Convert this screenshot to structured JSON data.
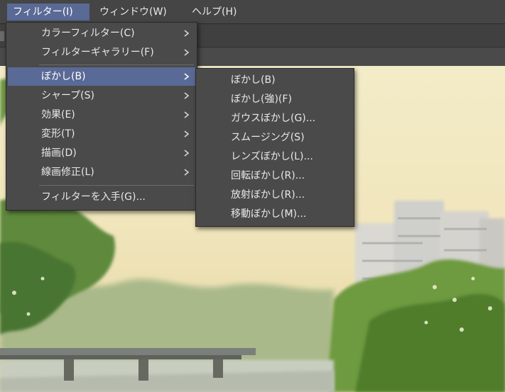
{
  "menubar": {
    "items": [
      {
        "label": "フィルター(I)",
        "active": true
      },
      {
        "label": "ウィンドウ(W)",
        "active": false
      },
      {
        "label": "ヘルプ(H)",
        "active": false
      }
    ]
  },
  "filter_menu": {
    "items": [
      {
        "label": "カラーフィルター(C)",
        "submenu": true
      },
      {
        "label": "フィルターギャラリー(F)",
        "submenu": true
      },
      {
        "label": "ぼかし(B)",
        "submenu": true,
        "highlighted": true
      },
      {
        "label": "シャープ(S)",
        "submenu": true
      },
      {
        "label": "効果(E)",
        "submenu": true
      },
      {
        "label": "変形(T)",
        "submenu": true
      },
      {
        "label": "描画(D)",
        "submenu": true
      },
      {
        "label": "線画修正(L)",
        "submenu": true
      },
      {
        "label": "フィルターを入手(G)...",
        "submenu": false
      }
    ]
  },
  "blur_submenu": {
    "items": [
      {
        "label": "ぼかし(B)"
      },
      {
        "label": "ぼかし(強)(F)"
      },
      {
        "label": "ガウスぼかし(G)..."
      },
      {
        "label": "スムージング(S)"
      },
      {
        "label": "レンズぼかし(L)..."
      },
      {
        "label": "回転ぼかし(R)..."
      },
      {
        "label": "放射ぼかし(R)..."
      },
      {
        "label": "移動ぼかし(M)..."
      }
    ]
  },
  "colors": {
    "menu_bg": "#4a4a4a",
    "highlight": "#5a6a96",
    "text": "#e8e8e8",
    "menubar_bg": "#454545"
  },
  "icons": {
    "submenu_arrow": "chevron-right-icon"
  }
}
